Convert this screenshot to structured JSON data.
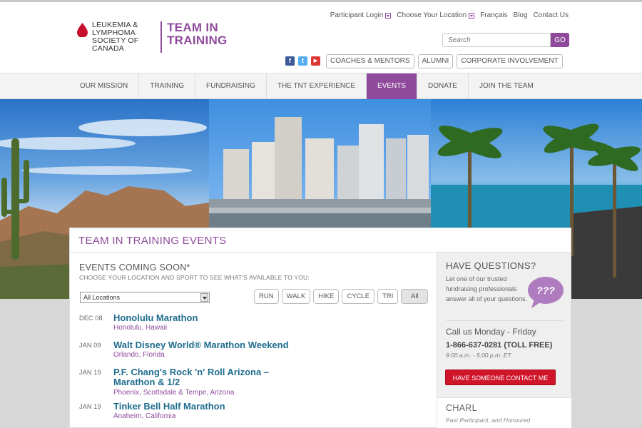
{
  "header": {
    "logo": {
      "org_name": "LEUKEMIA & LYMPHOMA SOCIETY OF CANADA",
      "program": "TEAM IN TRAINING"
    },
    "utility_links": [
      {
        "label": "Participant Login"
      },
      {
        "label": "Choose Your Location"
      },
      {
        "label": "Français"
      },
      {
        "label": "Blog"
      },
      {
        "label": "Contact Us"
      }
    ],
    "search": {
      "placeholder": "Search",
      "button": "GO"
    },
    "social": [
      "facebook-icon",
      "twitter-icon",
      "youtube-icon"
    ],
    "pills": [
      "COACHES & MENTORS",
      "ALUMNI",
      "CORPORATE INVOLVEMENT"
    ]
  },
  "nav": {
    "items": [
      {
        "label": "OUR MISSION"
      },
      {
        "label": "TRAINING"
      },
      {
        "label": "FUNDRAISING"
      },
      {
        "label": "THE TNT EXPERIENCE"
      },
      {
        "label": "EVENTS"
      },
      {
        "label": "DONATE"
      },
      {
        "label": "JOIN THE TEAM"
      }
    ],
    "active": "EVENTS"
  },
  "main": {
    "title": "TEAM IN TRAINING EVENTS",
    "events_heading": "EVENTS COMING SOON*",
    "events_sub": "CHOOSE YOUR LOCATION AND SPORT TO SEE WHAT'S AVAILABLE TO YOU:",
    "location_select": "All Locations",
    "sports": [
      "RUN",
      "WALK",
      "HIKE",
      "CYCLE",
      "TRI",
      "All"
    ],
    "active_sport": "All",
    "events": [
      {
        "date": "DEC 08",
        "name": "Honolulu Marathon",
        "place": "Honolulu, Hawaii"
      },
      {
        "date": "JAN 09",
        "name": "Walt Disney World® Marathon Weekend",
        "place": "Orlando, Florida"
      },
      {
        "date": "JAN 19",
        "name": "P.F. Chang's Rock 'n' Roll Arizona – Marathon & 1/2",
        "place": "Phoenix, Scottsdale & Tempe, Arizona"
      },
      {
        "date": "JAN 19",
        "name": "Tinker Bell Half Marathon",
        "place": "Anaheim, California"
      }
    ]
  },
  "sidebar": {
    "questions_heading": "HAVE QUESTIONS?",
    "questions_text": "Let one of our trusted fundraising professionals answer all of your questions.",
    "bubble_text": "???",
    "call_heading": "Call us Monday - Friday",
    "phone": "1-866-637-0281 (TOLL FREE)",
    "hours": "9:00 a.m. - 5:00 p.m. ET",
    "contact_button": "HAVE SOMEONE CONTACT ME",
    "testimonial_name": "CHARL",
    "testimonial_text": "Past Participant, and Honoured"
  },
  "colors": {
    "brand_purple": "#8f4a9c",
    "link_blue": "#1f6d8f",
    "cta_red": "#d0152b"
  }
}
